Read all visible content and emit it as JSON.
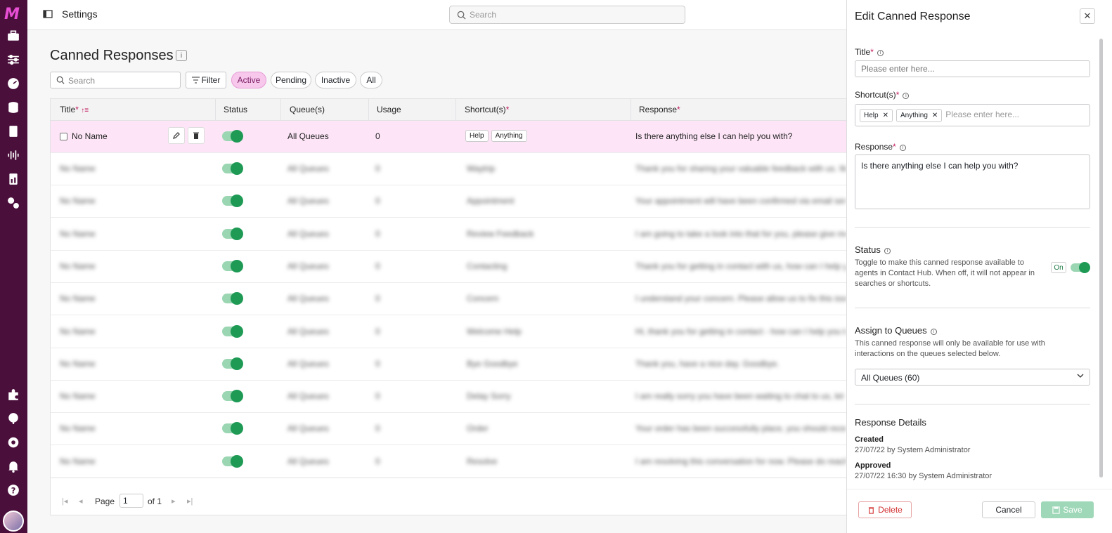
{
  "header": {
    "page": "Settings",
    "search_placeholder": "Search"
  },
  "nav": {
    "icons": [
      "logo-mark",
      "briefcase-icon",
      "sliders-icon",
      "dashboard-icon",
      "database-icon",
      "documents-icon",
      "audio-wave-icon",
      "report-icon",
      "settings-gears-icon",
      "puzzle-icon",
      "globe-icon",
      "gear-icon",
      "bell-icon",
      "help-icon",
      "user-avatar"
    ]
  },
  "page": {
    "title": "Canned Responses",
    "search_placeholder": "Search",
    "filter_label": "Filter",
    "chips": [
      "Active",
      "Pending",
      "Inactive",
      "All"
    ],
    "active_chip": "Active"
  },
  "table": {
    "columns": [
      "Title",
      "Status",
      "Queue(s)",
      "Usage",
      "Shortcut(s)",
      "Response"
    ],
    "required_marker": "*",
    "first_row": {
      "title": "No Name",
      "queue": "All Queues",
      "usage": "0",
      "shortcuts": [
        "Help",
        "Anything"
      ],
      "response": "Is there anything else I can help you with?"
    },
    "blurred_rows": [
      {
        "title": "No Name",
        "queue": "All Queues",
        "usage": "0",
        "shortcut": "Waytrip",
        "response": "Thank you for sharing your valuable feedback with us. We a..."
      },
      {
        "title": "No Name",
        "queue": "All Queues",
        "usage": "0",
        "shortcut": "Appointment",
        "response": "Your appointment will have been confirmed via email sent..."
      },
      {
        "title": "No Name",
        "queue": "All Queues",
        "usage": "0",
        "shortcut": "Review   Feedback",
        "response": "I am going to take a look into that for you, please give me ..."
      },
      {
        "title": "No Name",
        "queue": "All Queues",
        "usage": "0",
        "shortcut": "Contacting",
        "response": "Thank you for getting in contact with us, how can I help yo..."
      },
      {
        "title": "No Name",
        "queue": "All Queues",
        "usage": "0",
        "shortcut": "Concern",
        "response": "I understand your concern. Please allow us to fix this issu..."
      },
      {
        "title": "No Name",
        "queue": "All Queues",
        "usage": "0",
        "shortcut": "Welcome   Help",
        "response": "Hi, thank you for getting in contact - how can I help you to..."
      },
      {
        "title": "No Name",
        "queue": "All Queues",
        "usage": "0",
        "shortcut": "Bye   Goodbye",
        "response": "Thank you, have a nice day. Goodbye."
      },
      {
        "title": "No Name",
        "queue": "All Queues",
        "usage": "0",
        "shortcut": "Delay   Sorry",
        "response": "I am really sorry you have been waiting to chat to us, let m..."
      },
      {
        "title": "No Name",
        "queue": "All Queues",
        "usage": "0",
        "shortcut": "Order",
        "response": "Your order has been successfully place, you should receive..."
      },
      {
        "title": "No Name",
        "queue": "All Queues",
        "usage": "0",
        "shortcut": "Resolve",
        "response": "I am resolving this conversation for now. Please do reach ..."
      }
    ]
  },
  "pager": {
    "page_label": "Page",
    "page_value": "1",
    "of_label": "of 1"
  },
  "panel": {
    "title": "Edit Canned Response",
    "title_label": "Title",
    "title_placeholder": "Please enter here...",
    "shortcut_label": "Shortcut(s)",
    "shortcut_tags": [
      "Help",
      "Anything"
    ],
    "shortcut_placeholder": "Please enter here...",
    "response_label": "Response",
    "response_value": "Is there anything else I can help you with?",
    "status_title": "Status",
    "status_desc": "Toggle to make this canned response available to agents in Contact Hub. When off, it will not appear in searches or shortcuts.",
    "status_badge": "On",
    "queues_title": "Assign to Queues",
    "queues_desc": "This canned response will only be available for use with interactions on the queues selected below.",
    "queues_value": "All Queues (60)",
    "details_title": "Response Details",
    "created_label": "Created",
    "created_value": "27/07/22 by System Administrator",
    "approved_label": "Approved",
    "approved_value": "27/07/22 16:30 by System Administrator",
    "delete_label": "Delete",
    "cancel_label": "Cancel",
    "save_label": "Save"
  },
  "colors": {
    "nav_bg": "#4b0f3c",
    "accent": "#e84fd4",
    "active_chip": "#f7c8ec",
    "toggle_on": "#1e9a55",
    "delete": "#d32f2f",
    "save": "#9fd8b8"
  }
}
